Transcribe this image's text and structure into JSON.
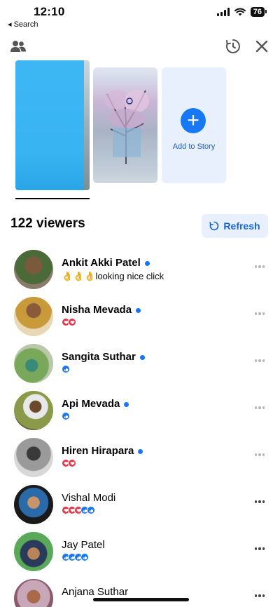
{
  "status": {
    "time": "12:10",
    "back_label": "◂ Search",
    "battery": "76"
  },
  "stories": {
    "add_label": "Add to Story"
  },
  "viewers_title": "122 viewers",
  "refresh_label": "Refresh",
  "viewers": [
    {
      "name": "Ankit Akki Patel",
      "unread": true,
      "sub": "👌👌👌looking nice click",
      "reactions": []
    },
    {
      "name": "Nisha Mevada",
      "unread": true,
      "sub": "",
      "reactions": [
        "heart",
        "heart"
      ]
    },
    {
      "name": "Sangita Suthar",
      "unread": true,
      "sub": "",
      "reactions": [
        "like"
      ]
    },
    {
      "name": "Api Mevada",
      "unread": true,
      "sub": "",
      "reactions": [
        "like"
      ]
    },
    {
      "name": "Hiren Hirapara",
      "unread": true,
      "sub": "",
      "reactions": [
        "heart",
        "heart"
      ]
    },
    {
      "name": "Vishal Modi",
      "unread": false,
      "sub": "",
      "reactions": [
        "heart",
        "heart",
        "heart",
        "like",
        "like"
      ]
    },
    {
      "name": "Jay Patel",
      "unread": false,
      "sub": "",
      "reactions": [
        "like",
        "like",
        "like",
        "like"
      ]
    },
    {
      "name": "Anjana Suthar",
      "unread": false,
      "sub": "",
      "reactions": []
    }
  ],
  "colors": {
    "accent": "#1877f2",
    "heart": "#e8344a",
    "refresh_bg": "#e7f0fc"
  },
  "icons": [
    "friends-icon",
    "archive-clock-icon",
    "close-icon",
    "plus-icon",
    "refresh-icon",
    "more-icon"
  ]
}
